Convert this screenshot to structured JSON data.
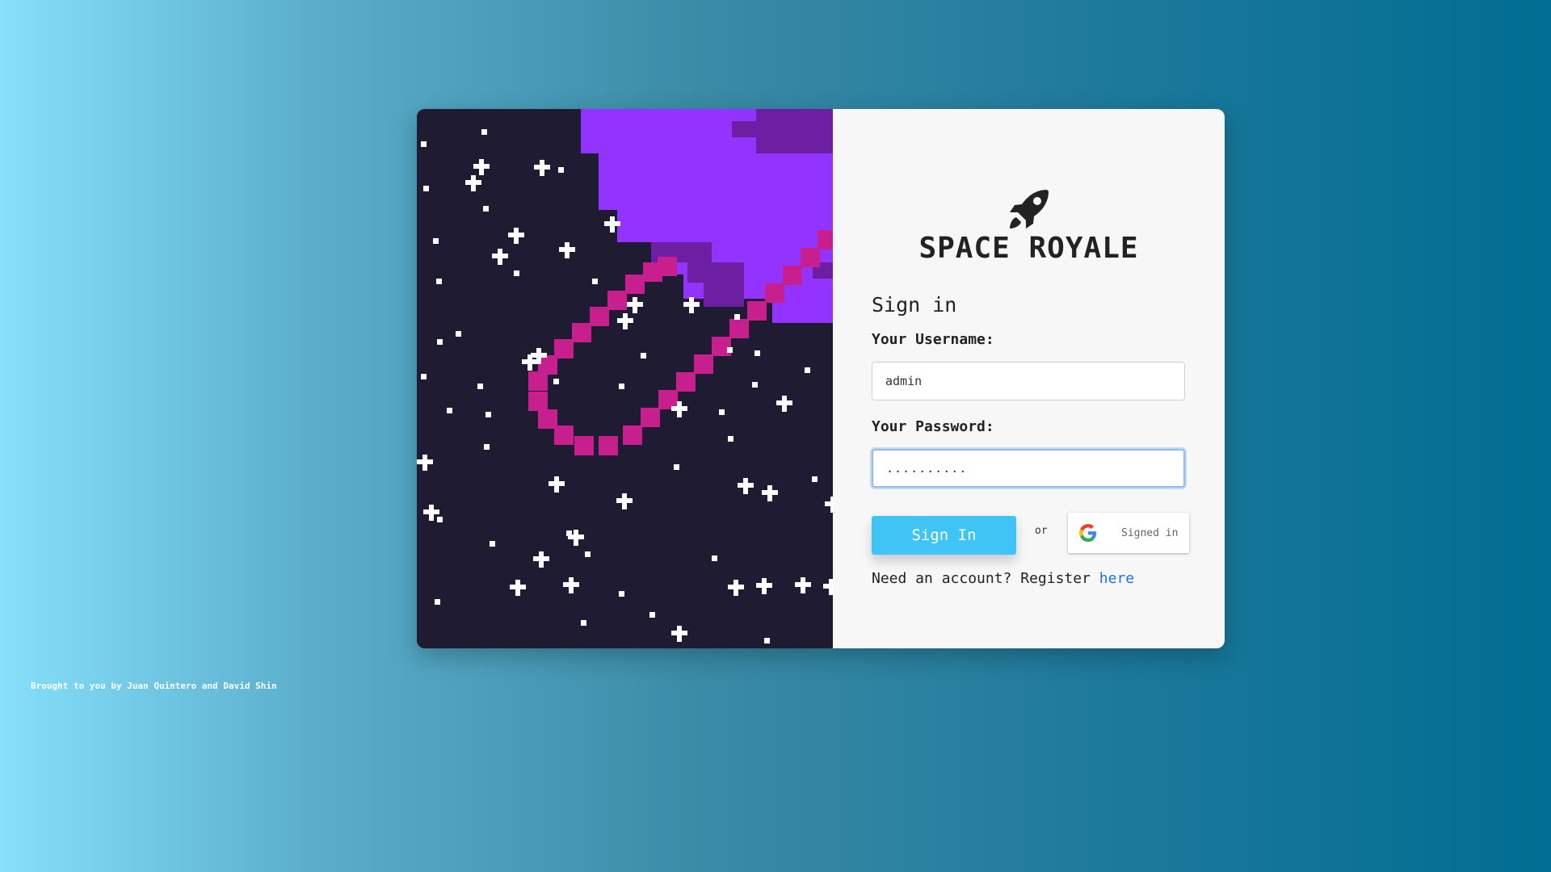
{
  "app": {
    "title": "SPACE ROYALE",
    "logo_icon": "rocket-icon"
  },
  "form": {
    "heading": "Sign in",
    "username_label": "Your Username:",
    "username_value": "admin",
    "password_label": "Your Password:",
    "password_value": "..........",
    "signin_label": "Sign In",
    "or_text": "or",
    "google_icon": "google-icon",
    "google_label": "Signed in",
    "register_prefix": "Need an account? Register ",
    "register_link": "here"
  },
  "footer": {
    "credits": "Brought to you by Juan Quintero and David Shin"
  },
  "colors": {
    "space_bg": "#1f1b32",
    "planet": "#9333ff",
    "planet_shadow": "#6c1fa3",
    "ring": "#c71f8e",
    "button": "#40c4f5",
    "link": "#1a73e8"
  }
}
